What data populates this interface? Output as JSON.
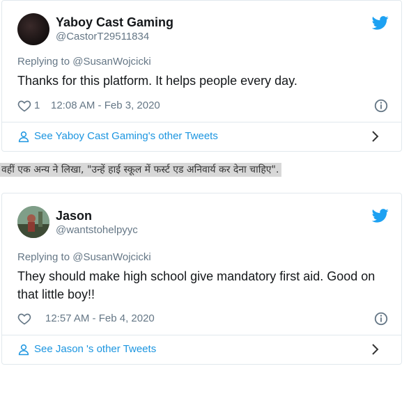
{
  "tweets": [
    {
      "name": "Yaboy Cast Gaming",
      "handle": "@CastorT29511834",
      "replying_prefix": "Replying to ",
      "replying_to": "@SusanWojcicki",
      "text": "Thanks for this platform. It helps people every day.",
      "like_count": "1",
      "timestamp": "12:08 AM - Feb 3, 2020",
      "footer": "See Yaboy Cast Gaming's other Tweets"
    },
    {
      "name": "Jason",
      "handle": "@wantstohelpyyc",
      "replying_prefix": "Replying to ",
      "replying_to": "@SusanWojcicki",
      "text_line1": "They should make high school give mandatory first aid. Good on",
      "text_line2": "that little boy!!",
      "like_count": "",
      "timestamp": "12:57 AM - Feb 4, 2020",
      "footer": "See Jason 's other Tweets"
    }
  ],
  "caption": "वहीं एक अन्य ने लिखा, \"उन्हें हाई स्कूल में फर्स्ट एड अनिवार्य कर देना चाहिए\".",
  "colors": {
    "twitter_blue": "#1da1f2",
    "link_blue": "#1b95e0",
    "muted": "#657786",
    "border": "#e1e8ed"
  },
  "icons": [
    "twitter-bird-icon",
    "heart-icon",
    "info-icon",
    "person-icon",
    "chevron-right-icon"
  ]
}
